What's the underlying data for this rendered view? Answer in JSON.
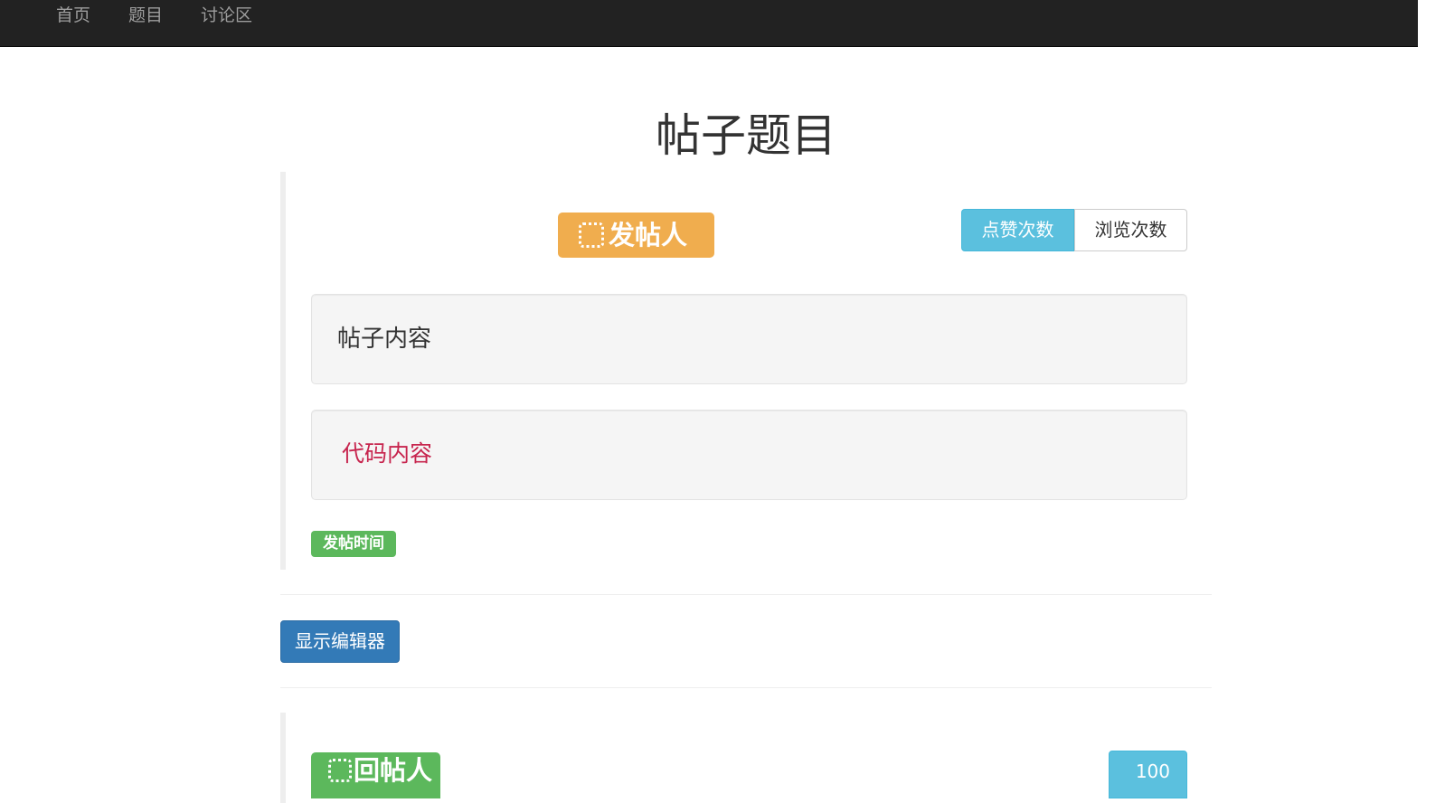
{
  "nav": {
    "items": [
      {
        "label": "首页"
      },
      {
        "label": "题目"
      },
      {
        "label": "讨论区"
      }
    ]
  },
  "post": {
    "title": "帖子题目",
    "author_label": "发帖人",
    "like_label": "点赞次数",
    "views_label": "浏览次数",
    "content": "帖子内容",
    "code": "代码内容",
    "time_label": "发帖时间"
  },
  "editor": {
    "show_button_label": "显示编辑器"
  },
  "reply": {
    "author_label": "回帖人",
    "count": "100"
  },
  "colors": {
    "navbar": "#222222",
    "warning": "#f0ad4e",
    "info": "#5bc0de",
    "success": "#5cb85c",
    "primary": "#337ab7",
    "code": "#c7254e"
  },
  "icons": {
    "author_icon": "certificate-icon",
    "replier_icon": "certificate-icon"
  }
}
